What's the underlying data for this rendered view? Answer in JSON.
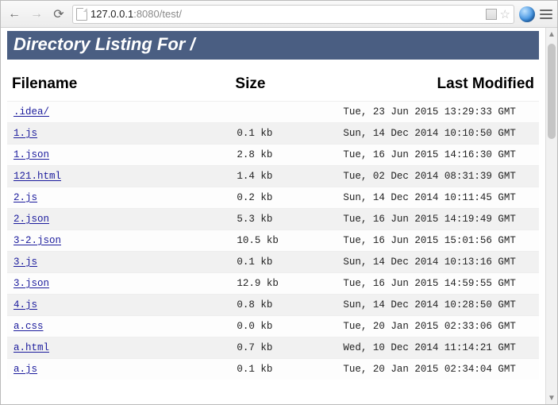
{
  "browser": {
    "url_host": "127.0.0.1",
    "url_rest": ":8080/test/"
  },
  "page": {
    "title": "Directory Listing For /",
    "columns": {
      "filename": "Filename",
      "size": "Size",
      "modified": "Last Modified"
    },
    "rows": [
      {
        "name": ".idea/",
        "size": "",
        "modified": "Tue, 23 Jun 2015 13:29:33 GMT"
      },
      {
        "name": "1.js",
        "size": "0.1 kb",
        "modified": "Sun, 14 Dec 2014 10:10:50 GMT"
      },
      {
        "name": "1.json",
        "size": "2.8 kb",
        "modified": "Tue, 16 Jun 2015 14:16:30 GMT"
      },
      {
        "name": "121.html",
        "size": "1.4 kb",
        "modified": "Tue, 02 Dec 2014 08:31:39 GMT"
      },
      {
        "name": "2.js",
        "size": "0.2 kb",
        "modified": "Sun, 14 Dec 2014 10:11:45 GMT"
      },
      {
        "name": "2.json",
        "size": "5.3 kb",
        "modified": "Tue, 16 Jun 2015 14:19:49 GMT"
      },
      {
        "name": "3-2.json",
        "size": "10.5 kb",
        "modified": "Tue, 16 Jun 2015 15:01:56 GMT"
      },
      {
        "name": "3.js",
        "size": "0.1 kb",
        "modified": "Sun, 14 Dec 2014 10:13:16 GMT"
      },
      {
        "name": "3.json",
        "size": "12.9 kb",
        "modified": "Tue, 16 Jun 2015 14:59:55 GMT"
      },
      {
        "name": "4.js",
        "size": "0.8 kb",
        "modified": "Sun, 14 Dec 2014 10:28:50 GMT"
      },
      {
        "name": "a.css",
        "size": "0.0 kb",
        "modified": "Tue, 20 Jan 2015 02:33:06 GMT"
      },
      {
        "name": "a.html",
        "size": "0.7 kb",
        "modified": "Wed, 10 Dec 2014 11:14:21 GMT"
      },
      {
        "name": "a.js",
        "size": "0.1 kb",
        "modified": "Tue, 20 Jan 2015 02:34:04 GMT"
      }
    ]
  }
}
